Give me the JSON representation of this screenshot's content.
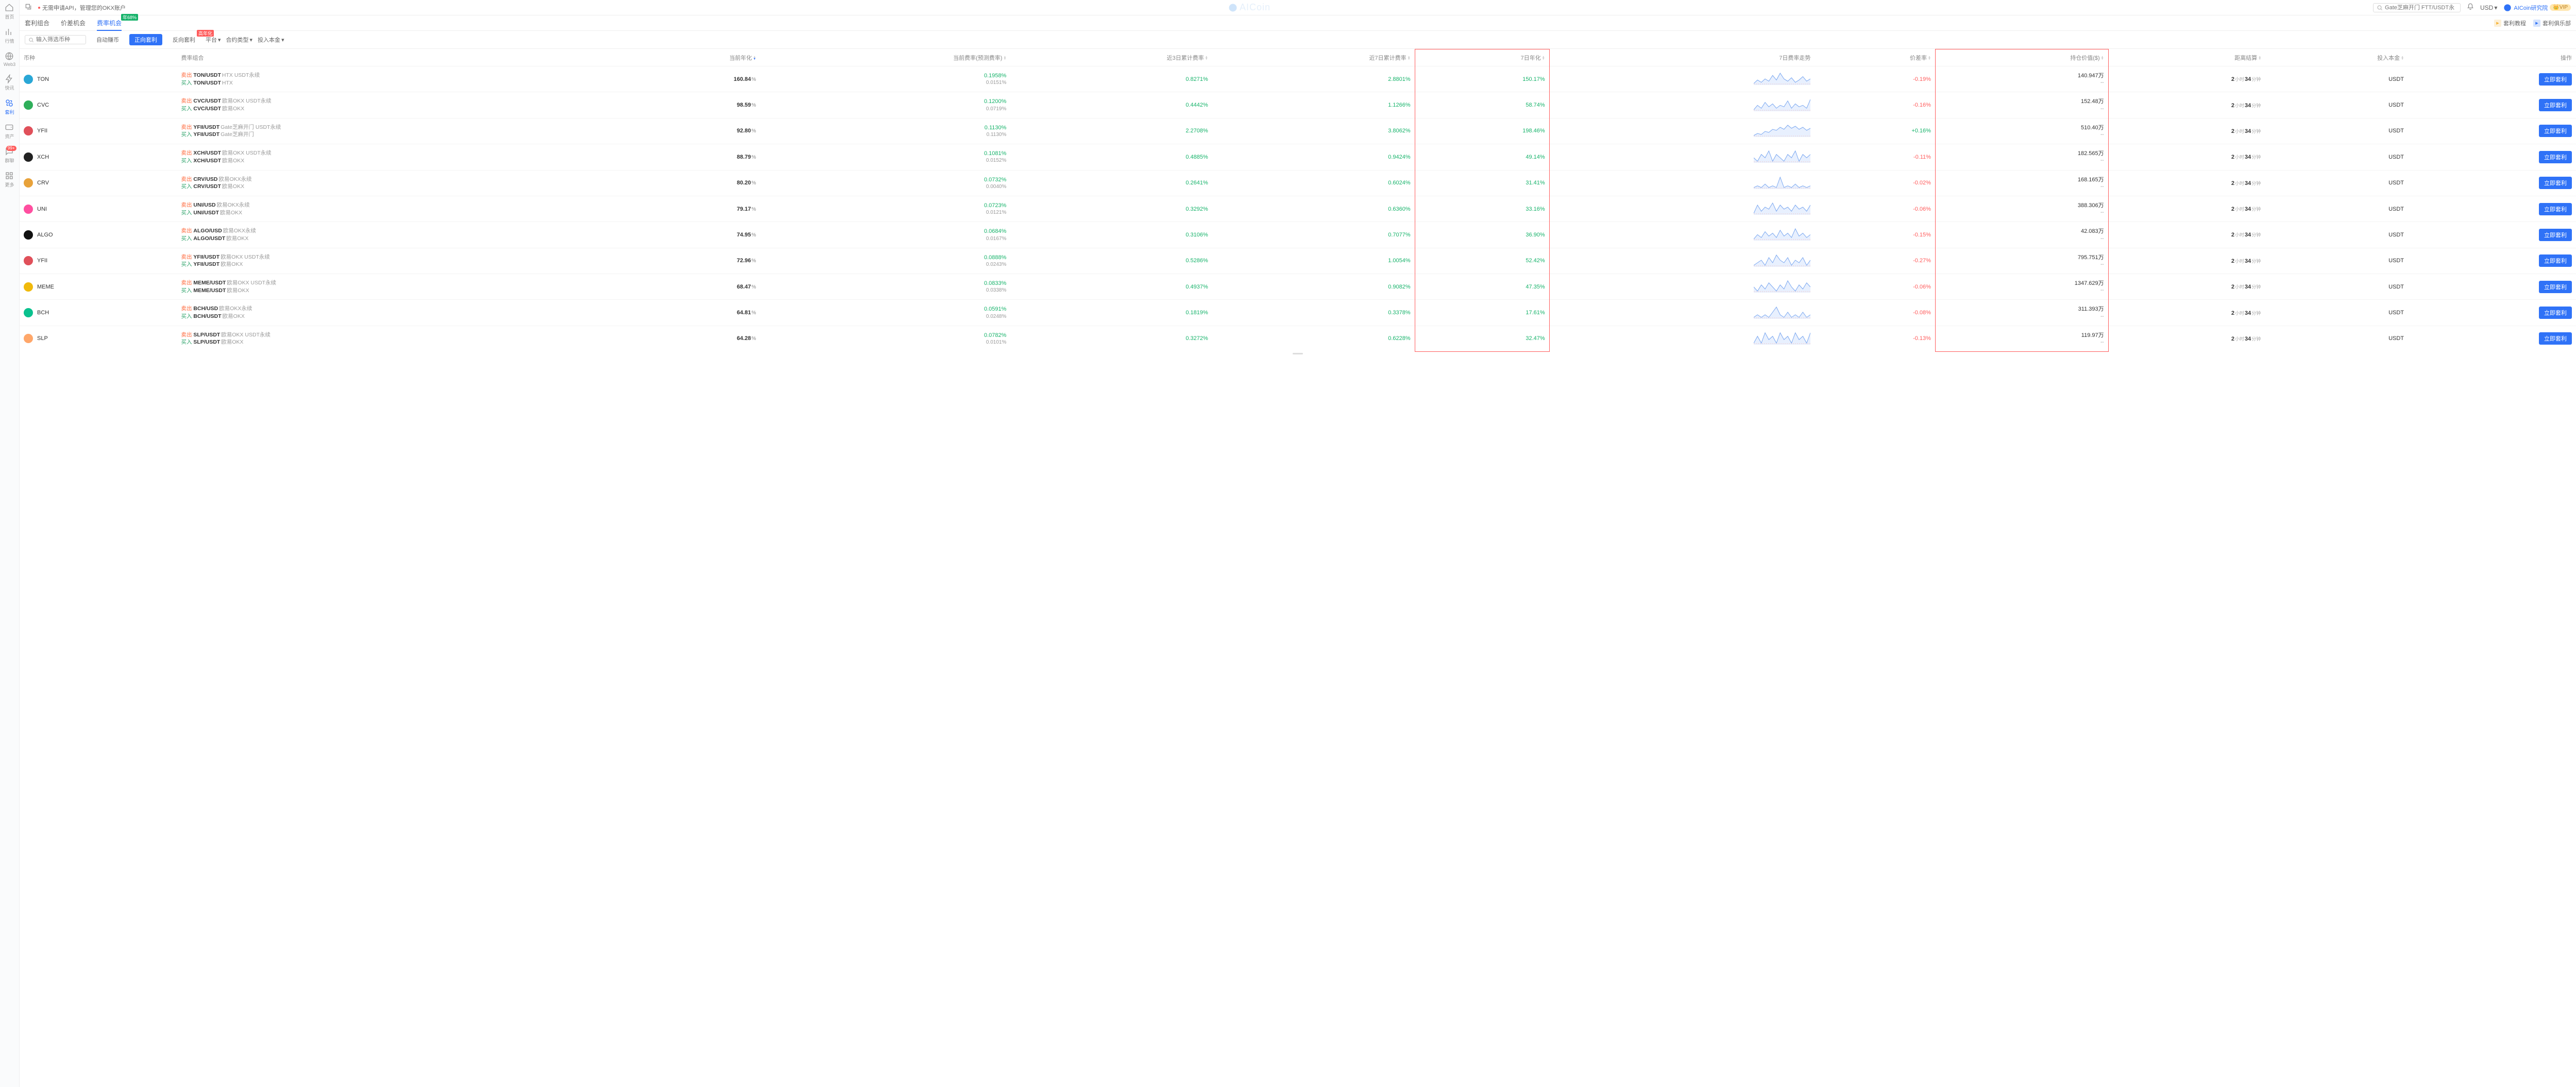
{
  "top": {
    "note": "无需申请API，管理您的OKX账户",
    "watermark": "AICoin",
    "search_placeholder": "Gate芝麻开门 FTT/USDT永",
    "currency": "USD",
    "account": "AICoin研究院",
    "vip": "VIP"
  },
  "sidebar": {
    "items": [
      {
        "label": "首页",
        "icon": "home"
      },
      {
        "label": "行情",
        "icon": "chart"
      },
      {
        "label": "Web3",
        "icon": "web3"
      },
      {
        "label": "快讯",
        "icon": "flash"
      },
      {
        "label": "套利",
        "icon": "arb",
        "active": true
      },
      {
        "label": "资产",
        "icon": "wallet"
      },
      {
        "label": "群聊",
        "icon": "chat",
        "badge": "99+"
      },
      {
        "label": "更多",
        "icon": "more"
      }
    ]
  },
  "tabs": {
    "items": [
      {
        "label": "套利组合"
      },
      {
        "label": "价差机会"
      },
      {
        "label": "费率机会",
        "active": true,
        "badge": "年68%",
        "badge_cls": "green"
      }
    ],
    "links": [
      {
        "label": "套利教程",
        "color": "#f7b436"
      },
      {
        "label": "套利俱乐部",
        "color": "#2f72f7"
      }
    ]
  },
  "filters": {
    "search_placeholder": "输入筛选币种",
    "auto": "自动赚币",
    "forward": "正向套利",
    "reverse": "反向套利",
    "reverse_badge": "高年化",
    "platform": "平台",
    "contract": "合约类型",
    "capital": "投入本金"
  },
  "columns": {
    "coin": "币种",
    "combo": "费率组合",
    "apr": "当前年化",
    "rate": "当前费率(预测费率)",
    "cum3": "近3日累计费率",
    "cum7": "近7日累计费率",
    "apr7": "7日年化",
    "trend": "7日费率走势",
    "spread": "价差率",
    "hold": "持仓价值($)",
    "settle": "距离结算",
    "capital": "投入本金",
    "action": "操作"
  },
  "action_label": "立即套利",
  "settle": {
    "h": "2",
    "hm": "小时",
    "m": "34",
    "mm": "分钟"
  },
  "rows": [
    {
      "sym": "TON",
      "sell": "TON/USDT",
      "sell_ex": "HTX USDT永续",
      "buy": "TON/USDT",
      "buy_ex": "HTX",
      "apr": "160.84",
      "rate": "0.1958",
      "rate2": "0.0151",
      "c3": "0.8271",
      "c7": "2.8801",
      "a7": "150.17",
      "spread": "-0.19",
      "hold": "140.947",
      "cap": "USDT",
      "ico": "#2aa7d6",
      "spark": [
        6,
        9,
        7,
        10,
        8,
        13,
        9,
        15,
        10,
        8,
        11,
        7,
        9,
        12,
        8,
        10
      ]
    },
    {
      "sym": "CVC",
      "sell": "CVC/USDT",
      "sell_ex": "欧易OKX USDT永续",
      "buy": "CVC/USDT",
      "buy_ex": "欧易OKX",
      "apr": "98.59",
      "rate": "0.1200",
      "rate2": "0.0719",
      "c3": "0.4442",
      "c7": "1.1266",
      "a7": "58.74",
      "spread": "-0.16",
      "hold": "152.48",
      "cap": "USDT",
      "ico": "#2fae5a",
      "spark": [
        5,
        8,
        6,
        10,
        7,
        9,
        6,
        8,
        7,
        11,
        6,
        9,
        7,
        8,
        6,
        12
      ]
    },
    {
      "sym": "YFII",
      "sell": "YFII/USDT",
      "sell_ex": "Gate芝麻开门 USDT永续",
      "buy": "YFII/USDT",
      "buy_ex": "Gate芝麻开门",
      "apr": "92.80",
      "rate": "0.1130",
      "rate2": "0.1130",
      "c3": "2.2708",
      "c7": "3.8062",
      "a7": "198.46",
      "spread": "+0.16",
      "spread_cls": "green",
      "hold": "510.40",
      "cap": "USDT",
      "ico": "#e0505a",
      "spark": [
        4,
        6,
        5,
        8,
        7,
        10,
        9,
        12,
        10,
        14,
        11,
        13,
        10,
        12,
        9,
        11
      ]
    },
    {
      "sym": "XCH",
      "sell": "XCH/USDT",
      "sell_ex": "欧易OKX USDT永续",
      "buy": "XCH/USDT",
      "buy_ex": "欧易OKX",
      "apr": "88.79",
      "rate": "0.1081",
      "rate2": "0.0152",
      "c3": "0.4885",
      "c7": "0.9424",
      "a7": "49.14",
      "spread": "-0.11",
      "hold": "182.565",
      "cap": "USDT",
      "ico": "#222",
      "spark": [
        7,
        6,
        8,
        7,
        9,
        6,
        8,
        7,
        6,
        8,
        7,
        9,
        6,
        8,
        7,
        8
      ]
    },
    {
      "sym": "CRV",
      "sell": "CRV/USD",
      "sell_ex": "欧易OKX永续",
      "buy": "CRV/USDT",
      "buy_ex": "欧易OKX",
      "apr": "80.20",
      "rate": "0.0732",
      "rate2": "0.0040",
      "c3": "0.2641",
      "c7": "0.6024",
      "a7": "31.41",
      "spread": "-0.02",
      "hold": "168.165",
      "cap": "USDT",
      "ico": "#e8a23a",
      "spark": [
        6,
        7,
        6,
        8,
        6,
        7,
        6,
        12,
        6,
        7,
        6,
        8,
        6,
        7,
        6,
        7
      ]
    },
    {
      "sym": "UNI",
      "sell": "UNI/USD",
      "sell_ex": "欧易OKX永续",
      "buy": "UNI/USDT",
      "buy_ex": "欧易OKX",
      "apr": "79.17",
      "rate": "0.0723",
      "rate2": "0.0121",
      "c3": "0.3292",
      "c7": "0.6360",
      "a7": "33.16",
      "spread": "-0.06",
      "hold": "388.306",
      "cap": "USDT",
      "ico": "#ff4fa0",
      "spark": [
        5,
        9,
        6,
        8,
        7,
        10,
        6,
        9,
        7,
        8,
        6,
        9,
        7,
        8,
        6,
        9
      ]
    },
    {
      "sym": "ALGO",
      "sell": "ALGO/USD",
      "sell_ex": "欧易OKX永续",
      "buy": "ALGO/USDT",
      "buy_ex": "欧易OKX",
      "apr": "74.95",
      "rate": "0.0684",
      "rate2": "0.0167",
      "c3": "0.3106",
      "c7": "0.7077",
      "a7": "36.90",
      "spread": "-0.15",
      "hold": "42.083",
      "cap": "USDT",
      "ico": "#111",
      "spark": [
        5,
        8,
        6,
        10,
        7,
        9,
        6,
        11,
        7,
        9,
        6,
        12,
        7,
        9,
        6,
        8
      ]
    },
    {
      "sym": "YFII",
      "sell": "YFII/USDT",
      "sell_ex": "欧易OKX USDT永续",
      "buy": "YFII/USDT",
      "buy_ex": "欧易OKX",
      "apr": "72.96",
      "rate": "0.0888",
      "rate2": "0.0243",
      "c3": "0.5286",
      "c7": "1.0054",
      "a7": "52.42",
      "spread": "-0.27",
      "hold": "795.751",
      "cap": "USDT",
      "ico": "#e0505a",
      "spark": [
        6,
        7,
        8,
        6,
        9,
        7,
        10,
        8,
        7,
        9,
        6,
        8,
        7,
        9,
        6,
        8
      ]
    },
    {
      "sym": "MEME",
      "sell": "MEME/USDT",
      "sell_ex": "欧易OKX USDT永续",
      "buy": "MEME/USDT",
      "buy_ex": "欧易OKX",
      "apr": "68.47",
      "rate": "0.0833",
      "rate2": "0.0338",
      "c3": "0.4937",
      "c7": "0.9082",
      "a7": "47.35",
      "spread": "-0.06",
      "hold": "1347.629",
      "cap": "USDT",
      "ico": "#f0b90b",
      "spark": [
        8,
        6,
        9,
        7,
        10,
        8,
        6,
        9,
        7,
        11,
        8,
        6,
        9,
        7,
        10,
        8
      ]
    },
    {
      "sym": "BCH",
      "sell": "BCH/USD",
      "sell_ex": "欧易OKX永续",
      "buy": "BCH/USDT",
      "buy_ex": "欧易OKX",
      "apr": "64.81",
      "rate": "0.0591",
      "rate2": "0.0248",
      "c3": "0.1819",
      "c7": "0.3378",
      "a7": "17.61",
      "spread": "-0.08",
      "hold": "311.393",
      "cap": "USDT",
      "ico": "#0ac18e",
      "spark": [
        6,
        7,
        6,
        7,
        6,
        8,
        10,
        7,
        6,
        8,
        6,
        7,
        6,
        8,
        6,
        7
      ]
    },
    {
      "sym": "SLP",
      "sell": "SLP/USDT",
      "sell_ex": "欧易OKX USDT永续",
      "buy": "SLP/USDT",
      "buy_ex": "欧易OKX",
      "apr": "64.28",
      "rate": "0.0782",
      "rate2": "0.0101",
      "c3": "0.3272",
      "c7": "0.6228",
      "a7": "32.47",
      "spread": "-0.13",
      "hold": "119.97",
      "cap": "USDT",
      "ico": "#ffa76a",
      "spark": [
        6,
        8,
        6,
        9,
        7,
        8,
        6,
        9,
        7,
        8,
        6,
        9,
        7,
        8,
        6,
        9
      ]
    }
  ]
}
